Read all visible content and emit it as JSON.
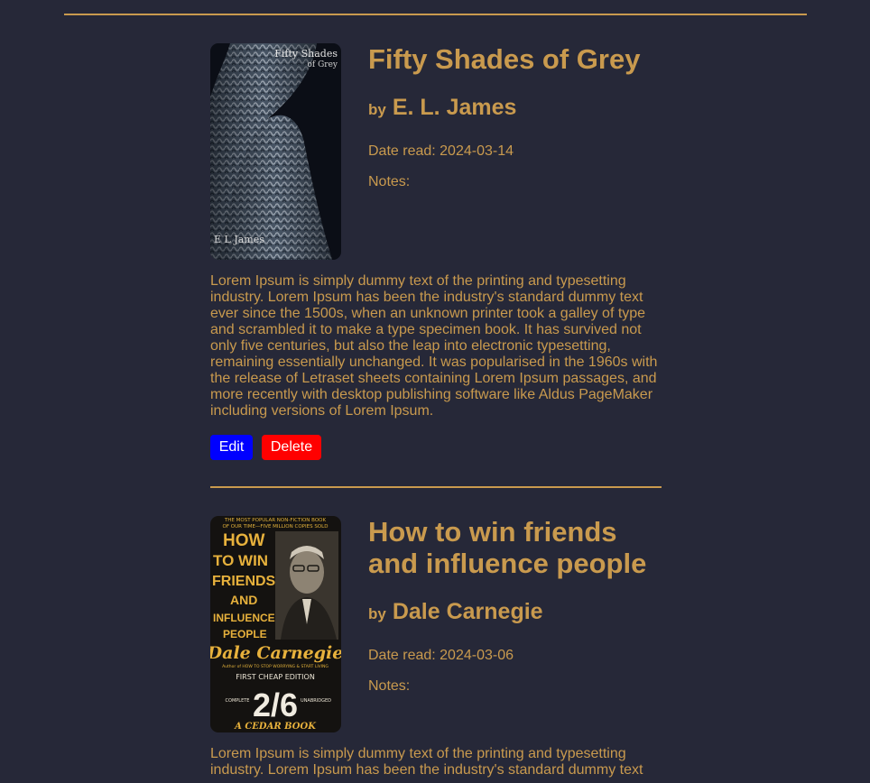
{
  "books": [
    {
      "title": "Fifty Shades of Grey",
      "by_label": "by",
      "author": "E. L. James",
      "date_read": "Date read: 2024-03-14",
      "notes_label": "Notes:",
      "cover": {
        "title_line1": "Fifty Shades",
        "title_line2": "of Grey",
        "author": "E L James"
      },
      "description": "Lorem Ipsum is simply dummy text of the printing and typesetting industry. Lorem Ipsum has been the industry's standard dummy text ever since the 1500s, when an unknown printer took a galley of type and scrambled it to make a type specimen book. It has survived not only five centuries, but also the leap into electronic typesetting, remaining essentially unchanged. It was popularised in the 1960s with the release of Letraset sheets containing Lorem Ipsum passages, and more recently with desktop publishing software like Aldus PageMaker including versions of Lorem Ipsum.",
      "edit_label": "Edit",
      "delete_label": "Delete"
    },
    {
      "title": "How to win friends and influence people",
      "by_label": "by",
      "author": "Dale Carnegie",
      "date_read": "Date read: 2024-03-06",
      "notes_label": "Notes:",
      "cover": {
        "top_line1": "THE MOST POPULAR NON-FICTION BOOK",
        "top_line2": "OF OUR TIME—FIVE MILLION COPIES SOLD",
        "title_lines": [
          "HOW",
          "TO WIN",
          "FRIENDS",
          "AND",
          "INFLUENCE",
          "PEOPLE"
        ],
        "author": "Dale Carnegie",
        "subtitle": "Author of HOW TO STOP WORRYING & START LIVING",
        "edition": "FIRST CHEAP EDITION",
        "complete": "COMPLETE",
        "unabridged": "UNABRIDGED",
        "price": "2/6",
        "publisher": "A CEDAR BOOK"
      },
      "description": "Lorem Ipsum is simply dummy text of the printing and typesetting industry. Lorem Ipsum has been the industry's standard dummy text"
    }
  ],
  "colors": {
    "background": "#262838",
    "accent": "#c99a4e",
    "edit": "#0000ff",
    "delete": "#ff0000"
  }
}
